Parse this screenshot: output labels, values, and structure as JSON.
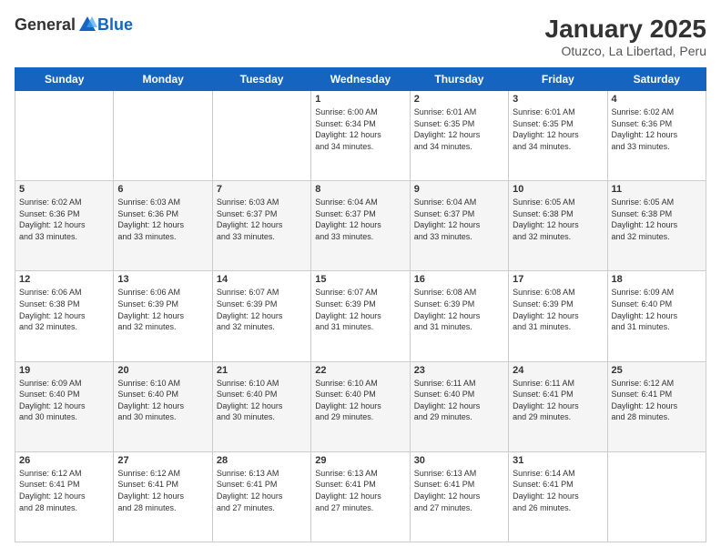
{
  "logo": {
    "general": "General",
    "blue": "Blue"
  },
  "header": {
    "month": "January 2025",
    "location": "Otuzco, La Libertad, Peru"
  },
  "days_of_week": [
    "Sunday",
    "Monday",
    "Tuesday",
    "Wednesday",
    "Thursday",
    "Friday",
    "Saturday"
  ],
  "weeks": [
    [
      {
        "day": "",
        "info": ""
      },
      {
        "day": "",
        "info": ""
      },
      {
        "day": "",
        "info": ""
      },
      {
        "day": "1",
        "info": "Sunrise: 6:00 AM\nSunset: 6:34 PM\nDaylight: 12 hours\nand 34 minutes."
      },
      {
        "day": "2",
        "info": "Sunrise: 6:01 AM\nSunset: 6:35 PM\nDaylight: 12 hours\nand 34 minutes."
      },
      {
        "day": "3",
        "info": "Sunrise: 6:01 AM\nSunset: 6:35 PM\nDaylight: 12 hours\nand 34 minutes."
      },
      {
        "day": "4",
        "info": "Sunrise: 6:02 AM\nSunset: 6:36 PM\nDaylight: 12 hours\nand 33 minutes."
      }
    ],
    [
      {
        "day": "5",
        "info": "Sunrise: 6:02 AM\nSunset: 6:36 PM\nDaylight: 12 hours\nand 33 minutes."
      },
      {
        "day": "6",
        "info": "Sunrise: 6:03 AM\nSunset: 6:36 PM\nDaylight: 12 hours\nand 33 minutes."
      },
      {
        "day": "7",
        "info": "Sunrise: 6:03 AM\nSunset: 6:37 PM\nDaylight: 12 hours\nand 33 minutes."
      },
      {
        "day": "8",
        "info": "Sunrise: 6:04 AM\nSunset: 6:37 PM\nDaylight: 12 hours\nand 33 minutes."
      },
      {
        "day": "9",
        "info": "Sunrise: 6:04 AM\nSunset: 6:37 PM\nDaylight: 12 hours\nand 33 minutes."
      },
      {
        "day": "10",
        "info": "Sunrise: 6:05 AM\nSunset: 6:38 PM\nDaylight: 12 hours\nand 32 minutes."
      },
      {
        "day": "11",
        "info": "Sunrise: 6:05 AM\nSunset: 6:38 PM\nDaylight: 12 hours\nand 32 minutes."
      }
    ],
    [
      {
        "day": "12",
        "info": "Sunrise: 6:06 AM\nSunset: 6:38 PM\nDaylight: 12 hours\nand 32 minutes."
      },
      {
        "day": "13",
        "info": "Sunrise: 6:06 AM\nSunset: 6:39 PM\nDaylight: 12 hours\nand 32 minutes."
      },
      {
        "day": "14",
        "info": "Sunrise: 6:07 AM\nSunset: 6:39 PM\nDaylight: 12 hours\nand 32 minutes."
      },
      {
        "day": "15",
        "info": "Sunrise: 6:07 AM\nSunset: 6:39 PM\nDaylight: 12 hours\nand 31 minutes."
      },
      {
        "day": "16",
        "info": "Sunrise: 6:08 AM\nSunset: 6:39 PM\nDaylight: 12 hours\nand 31 minutes."
      },
      {
        "day": "17",
        "info": "Sunrise: 6:08 AM\nSunset: 6:39 PM\nDaylight: 12 hours\nand 31 minutes."
      },
      {
        "day": "18",
        "info": "Sunrise: 6:09 AM\nSunset: 6:40 PM\nDaylight: 12 hours\nand 31 minutes."
      }
    ],
    [
      {
        "day": "19",
        "info": "Sunrise: 6:09 AM\nSunset: 6:40 PM\nDaylight: 12 hours\nand 30 minutes."
      },
      {
        "day": "20",
        "info": "Sunrise: 6:10 AM\nSunset: 6:40 PM\nDaylight: 12 hours\nand 30 minutes."
      },
      {
        "day": "21",
        "info": "Sunrise: 6:10 AM\nSunset: 6:40 PM\nDaylight: 12 hours\nand 30 minutes."
      },
      {
        "day": "22",
        "info": "Sunrise: 6:10 AM\nSunset: 6:40 PM\nDaylight: 12 hours\nand 29 minutes."
      },
      {
        "day": "23",
        "info": "Sunrise: 6:11 AM\nSunset: 6:40 PM\nDaylight: 12 hours\nand 29 minutes."
      },
      {
        "day": "24",
        "info": "Sunrise: 6:11 AM\nSunset: 6:41 PM\nDaylight: 12 hours\nand 29 minutes."
      },
      {
        "day": "25",
        "info": "Sunrise: 6:12 AM\nSunset: 6:41 PM\nDaylight: 12 hours\nand 28 minutes."
      }
    ],
    [
      {
        "day": "26",
        "info": "Sunrise: 6:12 AM\nSunset: 6:41 PM\nDaylight: 12 hours\nand 28 minutes."
      },
      {
        "day": "27",
        "info": "Sunrise: 6:12 AM\nSunset: 6:41 PM\nDaylight: 12 hours\nand 28 minutes."
      },
      {
        "day": "28",
        "info": "Sunrise: 6:13 AM\nSunset: 6:41 PM\nDaylight: 12 hours\nand 27 minutes."
      },
      {
        "day": "29",
        "info": "Sunrise: 6:13 AM\nSunset: 6:41 PM\nDaylight: 12 hours\nand 27 minutes."
      },
      {
        "day": "30",
        "info": "Sunrise: 6:13 AM\nSunset: 6:41 PM\nDaylight: 12 hours\nand 27 minutes."
      },
      {
        "day": "31",
        "info": "Sunrise: 6:14 AM\nSunset: 6:41 PM\nDaylight: 12 hours\nand 26 minutes."
      },
      {
        "day": "",
        "info": ""
      }
    ]
  ]
}
